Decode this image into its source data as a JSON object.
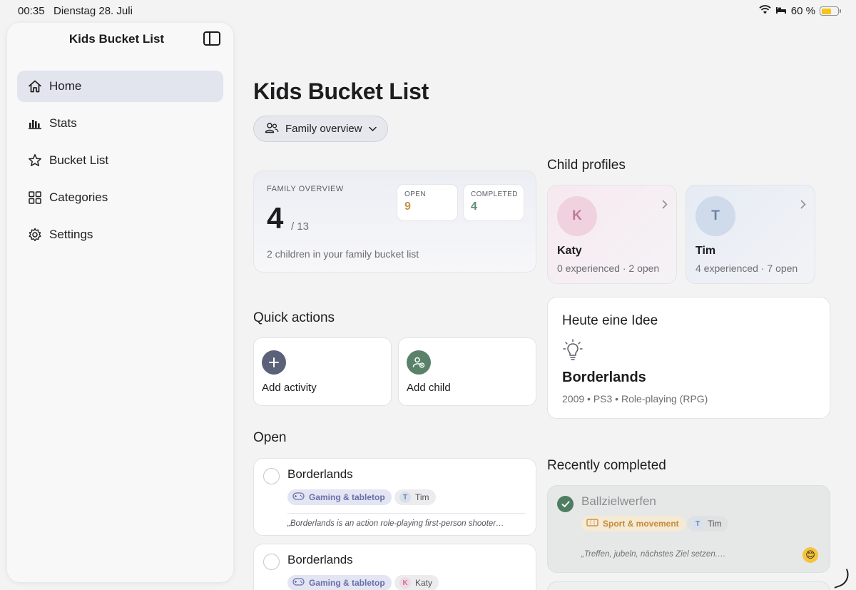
{
  "status_bar": {
    "time": "00:35",
    "date": "Dienstag 28. Juli",
    "battery": "60 %",
    "battery_level": 0.6,
    "icons": [
      "wifi-icon",
      "bed-icon",
      "battery-icon"
    ]
  },
  "sidebar": {
    "title": "Kids Bucket List",
    "items": [
      {
        "label": "Home",
        "icon": "house-icon",
        "active": true
      },
      {
        "label": "Stats",
        "icon": "bar-chart-icon",
        "active": false
      },
      {
        "label": "Bucket List",
        "icon": "star-icon",
        "active": false
      },
      {
        "label": "Categories",
        "icon": "grid-icon",
        "active": false
      },
      {
        "label": "Settings",
        "icon": "gear-icon",
        "active": false
      }
    ]
  },
  "main": {
    "title": "Kids Bucket List",
    "family_selector": "Family overview"
  },
  "overview": {
    "label": "FAMILY OVERVIEW",
    "count": "4",
    "total": "/ 13",
    "subtitle": "2 children in your family bucket list",
    "open_label": "OPEN",
    "open_value": "9",
    "completed_label": "COMPLETED",
    "completed_value": "4",
    "colors": {
      "open": "#c6924a",
      "completed": "#5d8a72"
    }
  },
  "quick_actions": {
    "heading": "Quick actions",
    "items": [
      {
        "label": "Add activity",
        "icon": "plus-icon",
        "color": "#5b6178"
      },
      {
        "label": "Add child",
        "icon": "person-add-icon",
        "color": "#5a826a"
      }
    ]
  },
  "open": {
    "heading": "Open",
    "items": [
      {
        "title": "Borderlands",
        "category": "Gaming & tabletop",
        "person_initial": "T",
        "person": "Tim",
        "quote": "„Borderlands is an action role-playing first-person shooter…"
      },
      {
        "title": "Borderlands",
        "category": "Gaming & tabletop",
        "person_initial": "K",
        "person": "Katy"
      }
    ]
  },
  "children": {
    "heading": "Child profiles",
    "items": [
      {
        "initial": "K",
        "name": "Katy",
        "meta": "0 experienced · 2 open",
        "color": "#c07a98"
      },
      {
        "initial": "T",
        "name": "Tim",
        "meta": "4 experienced · 7 open",
        "color": "#6c83a8"
      }
    ]
  },
  "idea": {
    "heading": "Heute eine Idee",
    "icon": "lightbulb-icon",
    "title": "Borderlands",
    "meta": "2009 • PS3 • Role-playing (RPG)"
  },
  "recent": {
    "heading": "Recently completed",
    "items": [
      {
        "title": "Ballzielwerfen",
        "category": "Sport & movement",
        "person_initial": "T",
        "person": "Tim",
        "quote": "„Treffen, jubeln, nächstes Ziel setzen.…",
        "emoji": "😊"
      }
    ]
  }
}
